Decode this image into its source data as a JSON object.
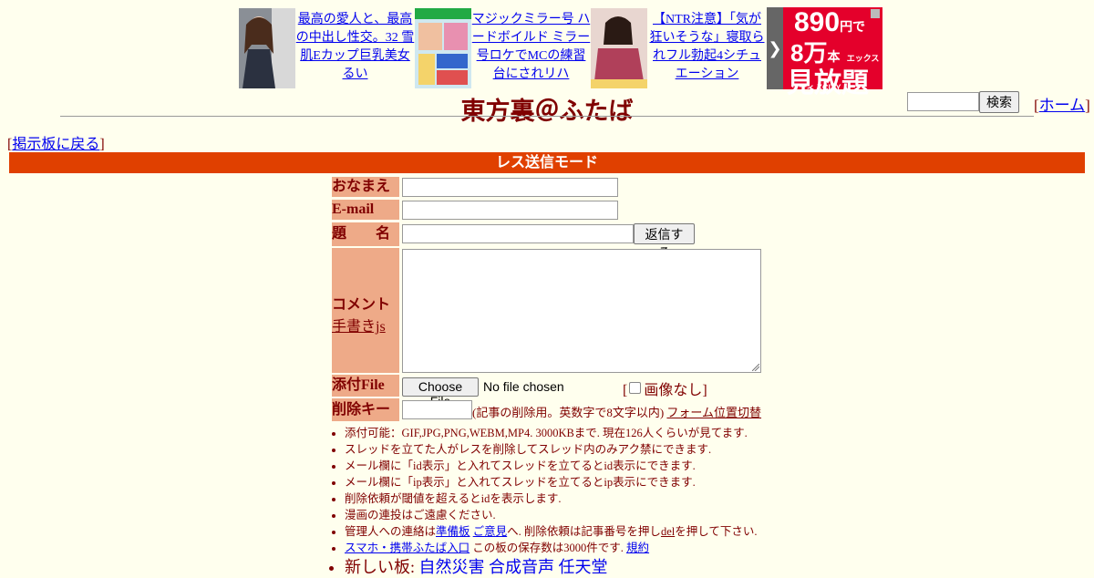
{
  "ads": [
    {
      "text": "最高の愛人と、最高の中出し性交。32 雪肌Eカップ巨乳美女 るい"
    },
    {
      "text": "マジックミラー号 ハードボイルド ミラー号ロケでMCの練習台にされリハ"
    },
    {
      "text": "【NTR注意】「気が狂いそうな」寝取られフル勃起4シチュエーション"
    }
  ],
  "banner": {
    "price": "890",
    "price_unit": "円で",
    "count": "8万",
    "count_unit": "本",
    "brand": "エックスシティ XCITY",
    "label": "見放題"
  },
  "header": {
    "title": "東方裏＠ふたば",
    "search_button": "検索",
    "home_link": "ホーム"
  },
  "nav": {
    "back_link": "掲示板に戻る"
  },
  "mode_bar": "レス送信モード",
  "form": {
    "name_label": "おなまえ",
    "email_label": "E-mail",
    "subject_label": "題　　名",
    "submit_button": "返信する",
    "comment_label": "コメント",
    "handwrite_link": "手書きjs",
    "file_label": "添付File",
    "choose_file_button": "Choose File",
    "no_file_text": "No file chosen",
    "no_image_label": "画像なし",
    "delete_key_label": "削除キー",
    "delete_key_note": "(記事の削除用。英数字で8文字以内)",
    "form_position_link": "フォーム位置切替"
  },
  "rules": {
    "r1": "添付可能：GIF,JPG,PNG,WEBM,MP4. 3000KBまで. 現在126人くらいが見てます.",
    "r2": "スレッドを立てた人がレスを削除してスレッド内のみアク禁にできます.",
    "r3": "メール欄に「id表示」と入れてスレッドを立てるとid表示にできます.",
    "r4": "メール欄に「ip表示」と入れてスレッドを立てるとip表示にできます.",
    "r5": "削除依頼が閾値を超えるとidを表示します.",
    "r6": "漫画の連投はご遠慮ください.",
    "r7_pre": "管理人への連絡は",
    "r7_link1": "準備板",
    "r7_link2": "ご意見",
    "r7_mid": "へ. 削除依頼は記事番号を押し",
    "r7_del": "del",
    "r7_post": "を押して下さい.",
    "r8_link": "スマホ・携帯ふたば入口",
    "r8_text": "この板の保存数は3000件です.",
    "r8_rules": "規約",
    "r9_label": "新しい板:",
    "r9_boards": [
      "自然災害",
      "合成音声",
      "任天堂"
    ]
  }
}
